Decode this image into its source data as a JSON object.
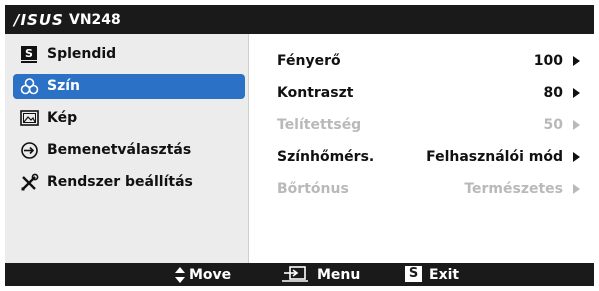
{
  "header": {
    "brand": "/ISUS",
    "model": "VN248"
  },
  "sidebar": {
    "items": [
      {
        "label": "Splendid",
        "icon": "splendid-icon"
      },
      {
        "label": "Szín",
        "icon": "color-icon",
        "active": true
      },
      {
        "label": "Kép",
        "icon": "image-icon"
      },
      {
        "label": "Bemenetválasztás",
        "icon": "input-select-icon"
      },
      {
        "label": "Rendszer beállítás",
        "icon": "system-setup-icon"
      }
    ]
  },
  "settings": {
    "rows": [
      {
        "label": "Fényerő",
        "value": "100",
        "enabled": true
      },
      {
        "label": "Kontraszt",
        "value": "80",
        "enabled": true
      },
      {
        "label": "Telítettség",
        "value": "50",
        "enabled": false
      },
      {
        "label": "Színhőmérs.",
        "value": "Felhasználói mód",
        "enabled": true
      },
      {
        "label": "Bőrtónus",
        "value": "Természetes",
        "enabled": false
      }
    ]
  },
  "footer": {
    "move": "Move",
    "menu": "Menu",
    "exit": "Exit",
    "exit_key": "S"
  },
  "colors": {
    "accent": "#2b72c6",
    "bar": "#1a1a1a",
    "sidebar_bg": "#ececec",
    "disabled": "#b9b9b9"
  }
}
